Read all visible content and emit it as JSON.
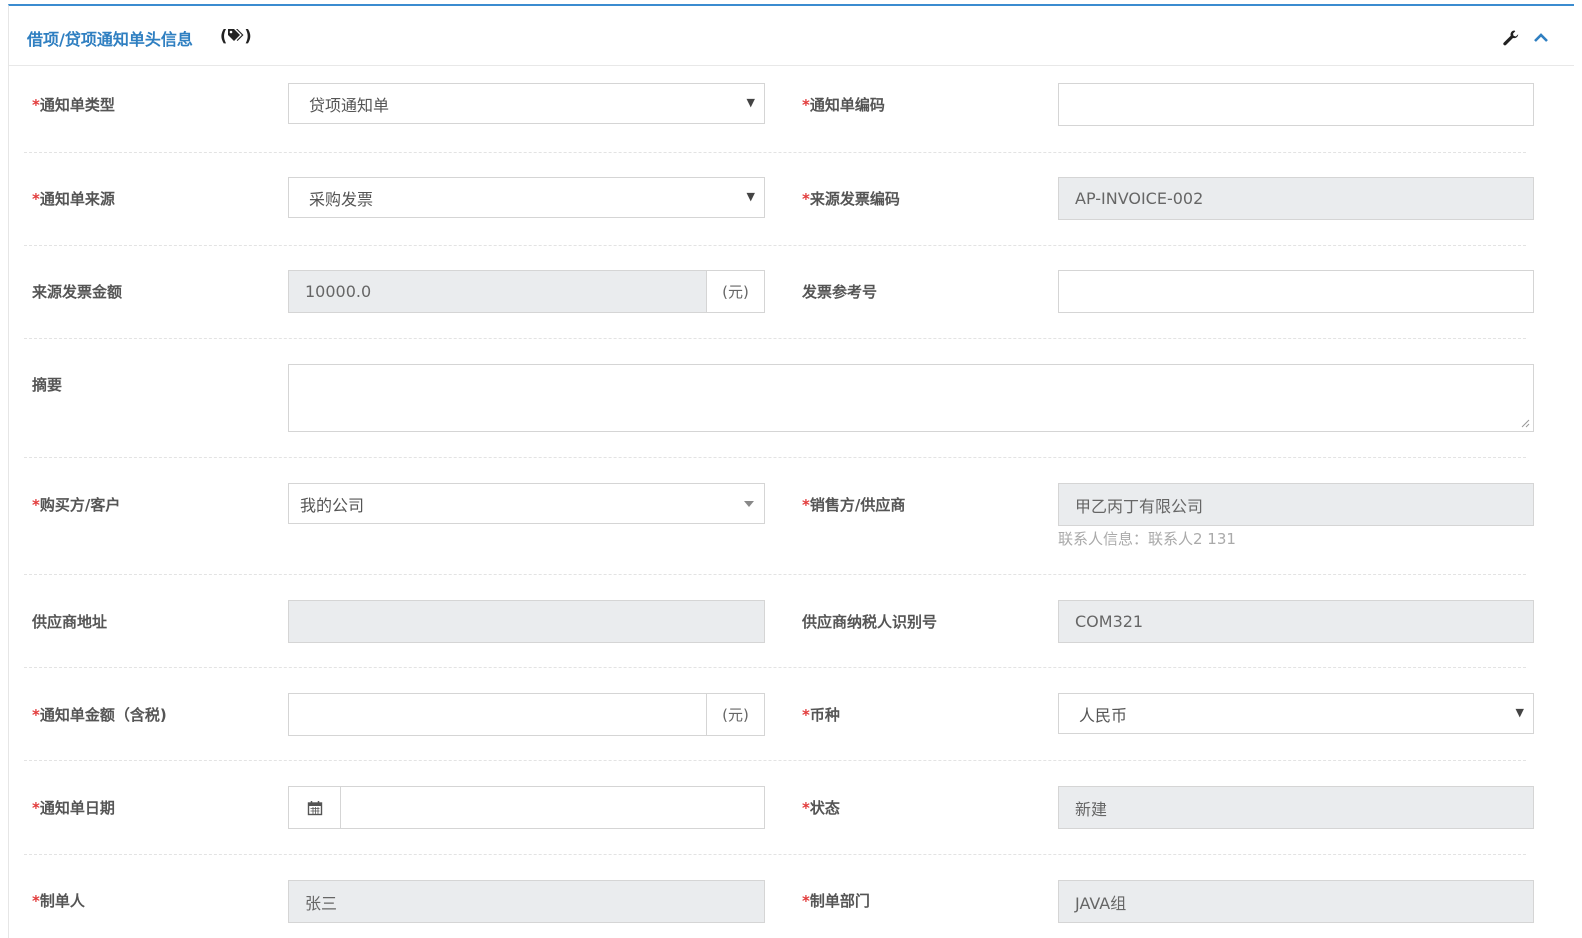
{
  "panel": {
    "title": "借项/贷项通知单头信息",
    "tag_open": "(",
    "tag_close": ")",
    "tag_icon": "tags-icon",
    "tools": [
      {
        "name": "wrench-icon"
      },
      {
        "name": "chevron-up-icon"
      }
    ],
    "accent_color": "#2f7fc1"
  },
  "form": {
    "notice_type": {
      "label": "通知单类型",
      "required": "*",
      "value": "贷项通知单"
    },
    "notice_code": {
      "label": "通知单编码",
      "required": "*",
      "value": ""
    },
    "notice_source": {
      "label": "通知单来源",
      "required": "*",
      "value": "采购发票"
    },
    "source_invoice_code": {
      "label": "来源发票编码",
      "required": "*",
      "value": "AP-INVOICE-002"
    },
    "source_invoice_amount": {
      "label": "来源发票金额",
      "value": "10000.0",
      "unit": "(元)"
    },
    "invoice_ref": {
      "label": "发票参考号",
      "value": ""
    },
    "summary": {
      "label": "摘要",
      "value": ""
    },
    "buyer": {
      "label": "购买方/客户",
      "required": "*",
      "value": "我的公司"
    },
    "seller": {
      "label": "销售方/供应商",
      "required": "*",
      "value": "甲乙丙丁有限公司",
      "contact_hint": "联系人信息：联系人2 131"
    },
    "supplier_address": {
      "label": "供应商地址",
      "value": ""
    },
    "supplier_tax_id": {
      "label": "供应商纳税人识别号",
      "value": "COM321"
    },
    "notice_amount": {
      "label": "通知单金额（含税)",
      "required": "*",
      "value": "",
      "unit": "(元)"
    },
    "currency": {
      "label": "币种",
      "required": "*",
      "value": "人民币"
    },
    "notice_date": {
      "label": "通知单日期",
      "required": "*",
      "value": "",
      "icon": "calendar-icon"
    },
    "status": {
      "label": "状态",
      "required": "*",
      "value": "新建"
    },
    "creator": {
      "label": "制单人",
      "required": "*",
      "value": "张三"
    },
    "creator_dept": {
      "label": "制单部门",
      "required": "*",
      "value": "JAVA组"
    }
  }
}
